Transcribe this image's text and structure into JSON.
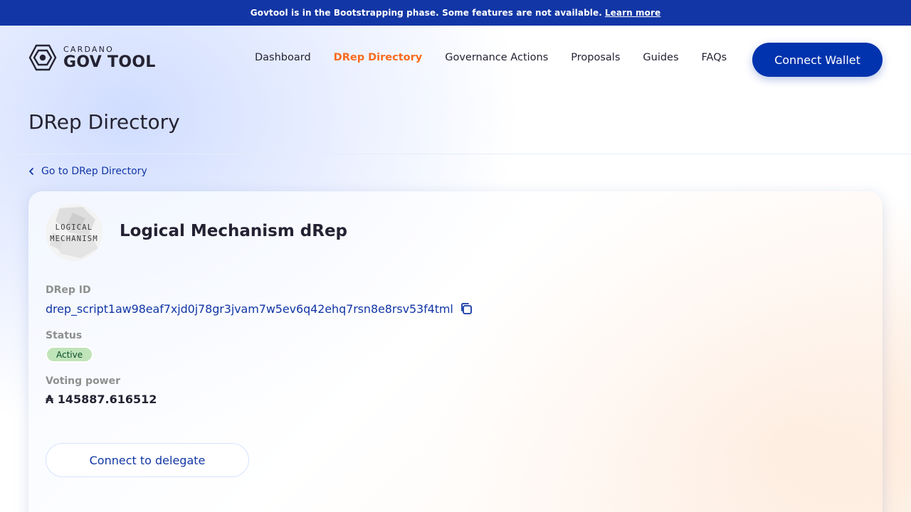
{
  "banner": {
    "message": "Govtool is in the Bootstrapping phase. Some features are not available.",
    "link_label": "Learn more"
  },
  "logo": {
    "small_text": "CARDANO",
    "big_text": "GOV TOOL"
  },
  "nav": {
    "items": [
      {
        "label": "Dashboard",
        "active": false
      },
      {
        "label": "DRep Directory",
        "active": true
      },
      {
        "label": "Governance Actions",
        "active": false
      },
      {
        "label": "Proposals",
        "active": false
      },
      {
        "label": "Guides",
        "active": false
      },
      {
        "label": "FAQs",
        "active": false
      }
    ],
    "connect_wallet_label": "Connect Wallet"
  },
  "page": {
    "title": "DRep Directory",
    "back_link_label": "Go to DRep Directory"
  },
  "drep": {
    "name": "Logical Mechanism dRep",
    "avatar_text_line1": "LOGICAL",
    "avatar_text_line2": "MECHANISM",
    "id_label": "DRep ID",
    "id": "drep_script1aw98eaf7xjd0j78gr3jvam7w5ev6q42ehq7rsn8e8rsv53f4tml",
    "status_label": "Status",
    "status": "Active",
    "voting_power_label": "Voting power",
    "voting_power": "₳ 145887.616512",
    "delegate_button_label": "Connect to delegate"
  },
  "colors": {
    "banner_bg": "#1236a5",
    "primary": "#0033ad",
    "accent_active": "#fa6a1e",
    "status_active_bg": "#c0e4ba"
  },
  "icons": {
    "logo": "cardano-govtool-logo-icon",
    "back": "chevron-left-icon",
    "copy": "copy-icon"
  }
}
